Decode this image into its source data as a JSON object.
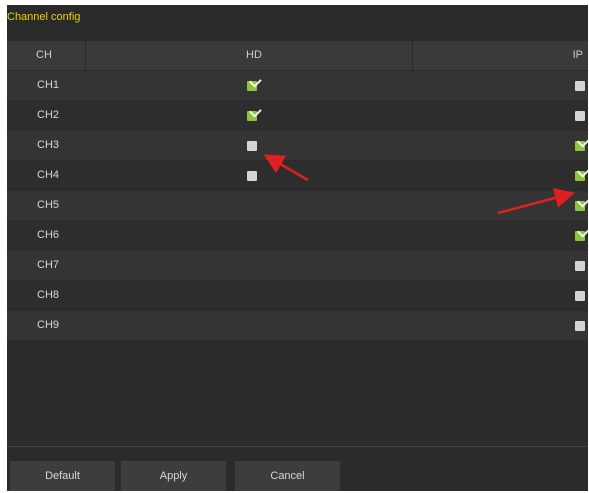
{
  "window": {
    "title": "Channel config"
  },
  "table": {
    "headers": {
      "ch": "CH",
      "hd": "HD",
      "ip": "IP"
    },
    "rows": [
      {
        "label": "CH1",
        "hd": "checked",
        "ip": "unchecked"
      },
      {
        "label": "CH2",
        "hd": "checked",
        "ip": "unchecked"
      },
      {
        "label": "CH3",
        "hd": "unchecked",
        "ip": "checked"
      },
      {
        "label": "CH4",
        "hd": "unchecked",
        "ip": "checked"
      },
      {
        "label": "CH5",
        "hd": "none",
        "ip": "checked"
      },
      {
        "label": "CH6",
        "hd": "none",
        "ip": "checked"
      },
      {
        "label": "CH7",
        "hd": "none",
        "ip": "unchecked"
      },
      {
        "label": "CH8",
        "hd": "none",
        "ip": "unchecked"
      },
      {
        "label": "CH9",
        "hd": "none",
        "ip": "unchecked"
      }
    ]
  },
  "buttons": {
    "default": "Default",
    "apply": "Apply",
    "cancel": "Cancel"
  },
  "colors": {
    "title_text": "#e8d400",
    "checkbox_checked": "#8cc63f",
    "checkbox_unchecked": "#d4d4d4",
    "annotation_arrow": "#e02020"
  },
  "annotations": [
    "arrow-pointing-to-ch3-hd-checkbox",
    "arrow-pointing-to-ch4-ip-checkbox"
  ]
}
